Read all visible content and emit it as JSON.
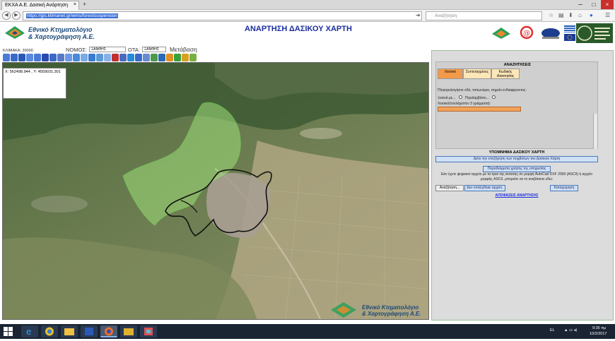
{
  "browser": {
    "tab_title": "ΕΚΧΑ Α.Ε. Δασική Ανάρτηση",
    "tab_close": "×",
    "new_tab": "+",
    "url": "https://gis.ktimanet.gr/wms/forestsuspension",
    "search_placeholder": "Αναζήτηση",
    "window_controls": [
      "─",
      "□",
      "×"
    ]
  },
  "header": {
    "logo_line1": "Εθνικό Κτηματολόγιο",
    "logo_line2": "& Χαρτογράφηση Α.Ε.",
    "title": "ΑΝΑΡΤΗΣΗ ΔΑΣΙΚΟΥ ΧΑΡΤΗ"
  },
  "controls": {
    "nomos_label": "ΝΟΜΟΣ:",
    "nomos_value": "ΞΑΝΘΗΣ",
    "ota_label": "ΟΤΑ:",
    "ota_value": "ΞΑΝΘΗΣ",
    "goto_label": "Μετάβαση",
    "scale_label": "ΚΛΙΜΑΚΑ: 30000"
  },
  "map": {
    "coords": "X: 562498.944 , Y: 4559031.301",
    "watermark_line1": "Εθνικό Κτηματολόγιο",
    "watermark_line2": "& Χαρτογράφηση Α.Ε."
  },
  "panel": {
    "search_title": "ΑΝΑΖΗΤΗΣΕΙΣ",
    "tabs": [
      "Λεκτικό",
      "Συντεταγμένες",
      "Κωδικός ιδιοκτησίας"
    ],
    "hint": "Πληκτρολογήστε οδό, τοπωνύμιο, σημείο ενδιαφέροντος:",
    "starts_with": "Ξεκινά με...",
    "contains": "Περιλαμβάνει...",
    "text_label": "Λεκτικό(τουλάχιστον 3 γράμματα):",
    "legend_title": "ΥΠΟΜΝΗΜΑ ΔΑΣΙΚΟΥ ΧΑΡΤΗ",
    "legend_button": "Δείτε την επεξήγηση των συμβόλων του Δασικού Χάρτη",
    "examples_button": "Παραδείγματα χρήσης της υπηρεσίας",
    "upload_note": "Εάν έχετε ψηφιακό αρχείο με τα όρια της έκτασης σε μορφή AutoCad DXF 2000 (ASCII) ή αρχείο μορφής ASCII, μπορείτε να το ανεβάσετε εδώ:",
    "browse_button": "Αναζήτηση...",
    "no_file_text": "Δεν επιλέχθηκε αρχείο.",
    "submit_button": "Καταχώρηση",
    "decisions_link": "ΑΠΟΦΑΣΕΙΣ ΑΝΑΡΤΗΣΗΣ"
  },
  "taskbar": {
    "lang": "EL",
    "time": "9:35 πμ",
    "date": "10/2/2017"
  }
}
